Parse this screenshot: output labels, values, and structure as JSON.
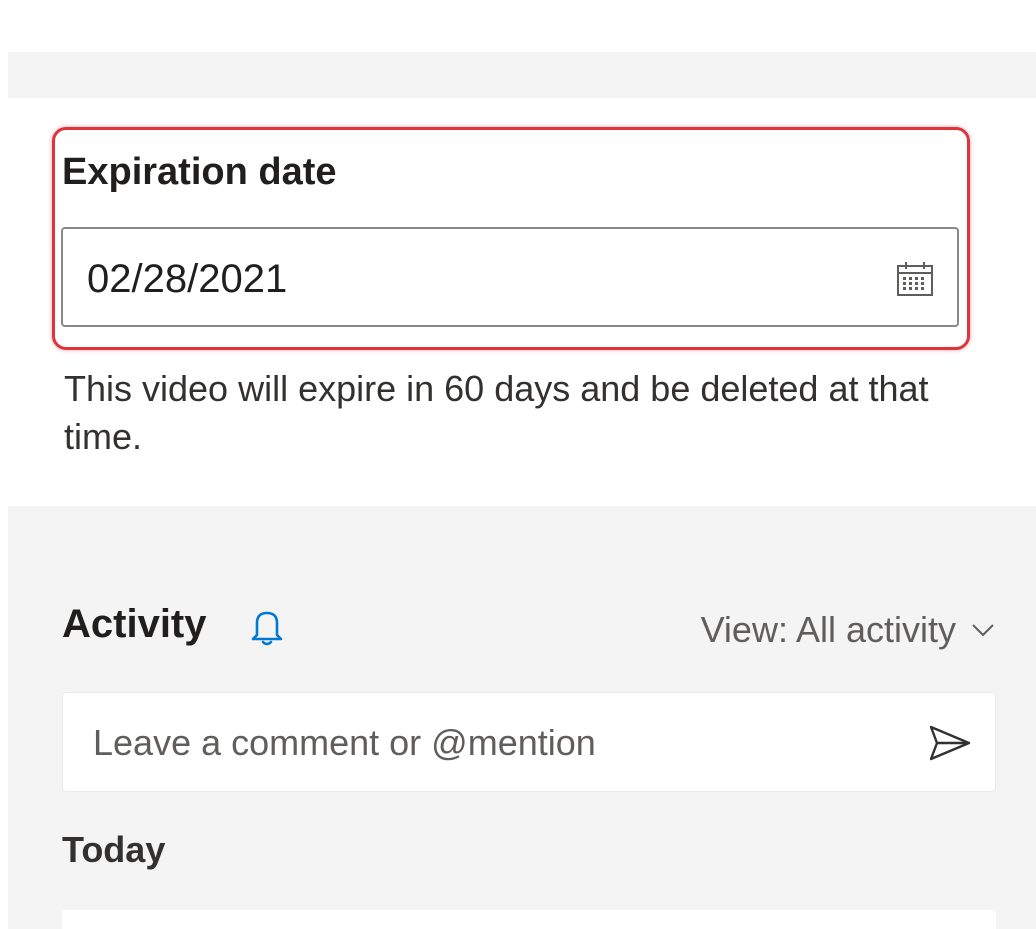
{
  "expiration": {
    "label": "Expiration date",
    "date_value": "02/28/2021",
    "hint": "This video will expire in 60 days and be deleted at that time.",
    "icon": "calendar-icon"
  },
  "activity": {
    "title": "Activity",
    "bell_icon": "bell-icon",
    "view_label": "View: All activity",
    "comment_placeholder": "Leave a comment or @mention",
    "send_icon": "send-icon",
    "today_label": "Today"
  },
  "colors": {
    "highlight": "#e0343c",
    "accent": "#0078d4",
    "panel_bg": "#f4f4f4"
  }
}
